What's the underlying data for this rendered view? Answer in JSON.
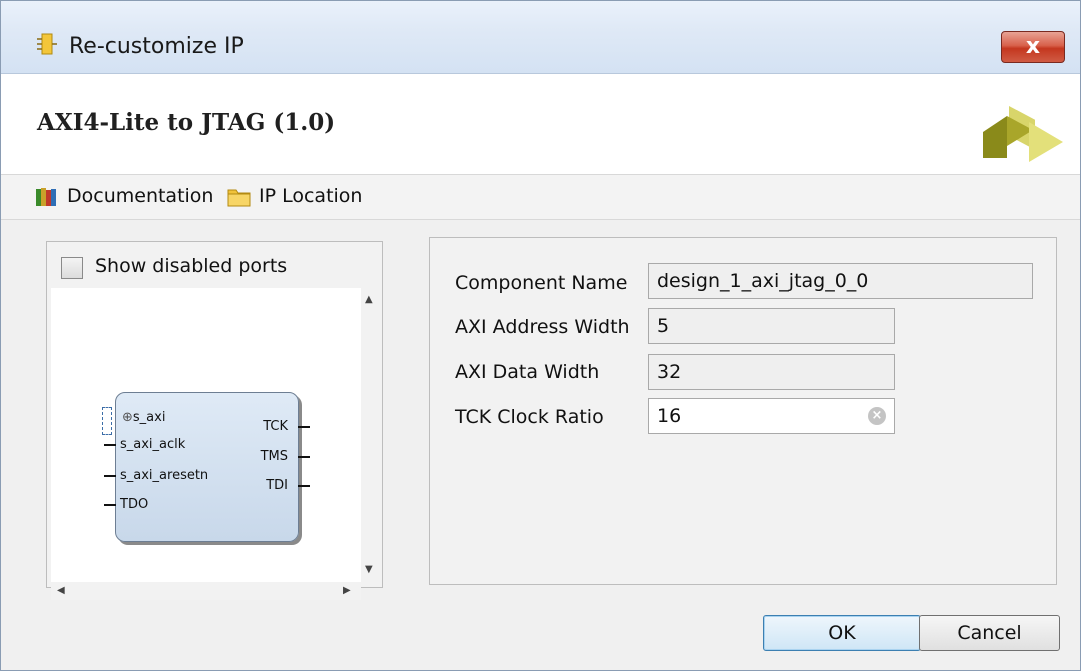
{
  "window": {
    "title": "Re-customize IP",
    "close_label": "x"
  },
  "header": {
    "ip_title": "AXI4-Lite to JTAG (1.0)",
    "logo_icon": "vivado-logo-icon"
  },
  "toolbar": {
    "documentation": "Documentation",
    "ip_location": "IP Location"
  },
  "symbol_panel": {
    "show_disabled_ports_label": "Show disabled ports",
    "show_disabled_ports_checked": false,
    "block": {
      "left_ports": [
        "s_axi",
        "s_axi_aclk",
        "s_axi_aresetn",
        "TDO"
      ],
      "right_ports": [
        "TCK",
        "TMS",
        "TDI"
      ]
    }
  },
  "params": {
    "component_name": {
      "label": "Component Name",
      "value": "design_1_axi_jtag_0_0"
    },
    "address_width": {
      "label": "AXI Address Width",
      "value": "5"
    },
    "data_width": {
      "label": "AXI Data Width",
      "value": "32"
    },
    "tck_clock_ratio": {
      "label": "TCK Clock Ratio",
      "value": "16"
    }
  },
  "footer": {
    "ok_label": "OK",
    "cancel_label": "Cancel"
  },
  "colors": {
    "accent": "#3c7fb1",
    "close": "#c4371f",
    "logo_dark": "#8a8a1a",
    "logo_light": "#e3e07a"
  }
}
